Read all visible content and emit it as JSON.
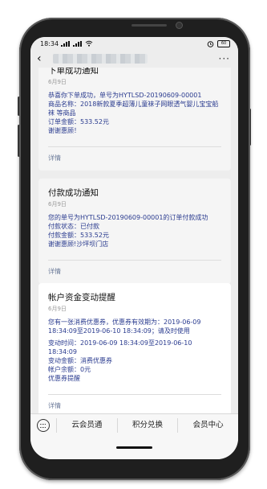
{
  "status_bar": {
    "time": "18:34",
    "signal_text": "..l ..l",
    "wifi_icon": "wifi-icon",
    "alarm_icon": "alarm-icon",
    "battery": "60"
  },
  "navbar": {
    "back_icon": "back-arrow-icon",
    "more_label": "···"
  },
  "cards": [
    {
      "title": "下单成功通知",
      "date": "6月9日",
      "lines": [
        "恭喜你下单成功，单号为HYTLSD-20190609-00001",
        "商品名称：2018新款夏季超薄儿童袜子网眼透气婴儿宝宝船袜 等商品",
        "订单金额：533.52元",
        "谢谢惠顾！"
      ],
      "detail": "详情"
    },
    {
      "title": "付款成功通知",
      "date": "6月9日",
      "lines": [
        "您的单号为HYTLSD-20190609-00001的订单付款成功",
        "付款状态：已付款",
        "付款金额：533.52元",
        "谢谢惠顾!沙坪坝门店"
      ],
      "detail": "详情"
    },
    {
      "title": "帐户资金变动提醒",
      "date": "6月9日",
      "lines": [
        "您有一张消费优惠券，优惠券有效期为：2019-06-09 18:34:09至2019-06-10 18:34:09；请及时使用",
        "",
        "变动时间：2019-06-09 18:34:09至2019-06-10 18:34:09",
        "变动金额：消费优惠券",
        "帐户余额：0元",
        "优惠券提醒"
      ],
      "detail": "详情"
    }
  ],
  "menu": {
    "keyboard_icon": "keyboard-icon",
    "items": [
      "云会员通",
      "积分兑换",
      "会员中心"
    ]
  }
}
